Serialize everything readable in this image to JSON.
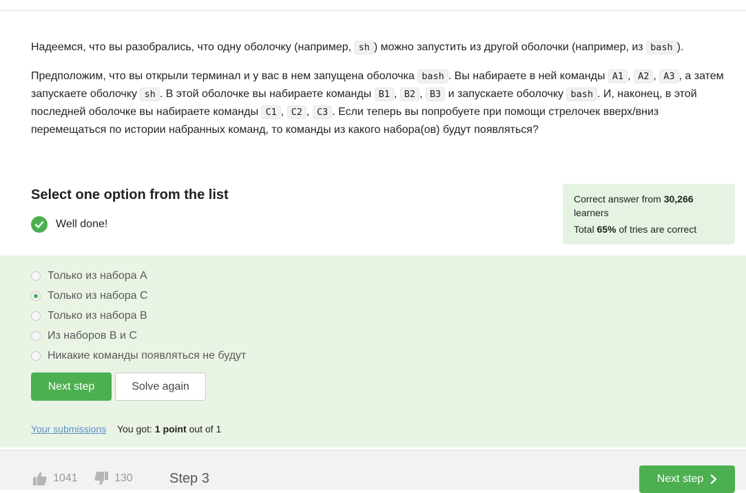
{
  "question": {
    "p1": {
      "t1": "Надеемся, что вы разобрались, что одну оболочку (например,",
      "c1": "sh",
      "t2": ") можно запустить из другой оболочки (например, из",
      "c2": "bash",
      "t3": ")."
    },
    "p2": {
      "t1": "Предположим, что вы открыли терминал и у вас в нем запущена оболочка",
      "c1": "bash",
      "t2": ". Вы набираете в ней команды",
      "c2": "A1",
      "s1": ",",
      "c3": "A2",
      "s2": ",",
      "c4": "A3",
      "t3": ", а затем запускаете оболочку",
      "c5": "sh",
      "t4": ". В этой оболочке вы набираете команды",
      "c6": "B1",
      "s3": ",",
      "c7": "B2",
      "s4": ",",
      "c8": "B3",
      "t5": "и запускаете оболочку",
      "c9": "bash",
      "t6": ". И, наконец, в этой последней оболочке вы набираете команды",
      "c10": "C1",
      "s5": ",",
      "c11": "C2",
      "s6": ",",
      "c12": "C3",
      "t7": ". Если теперь вы попробуете при помощи стрелочек вверх/вниз перемещаться по истории набранных команд, то команды из какого набора(ов) будут появляться?"
    }
  },
  "select_title": "Select one option from the list",
  "well_done": "Well done!",
  "stats": {
    "line1_prefix": "Correct answer from",
    "learners_count": "30,266",
    "line1_suffix": "learners",
    "line2_prefix": "Total",
    "percent": "65%",
    "line2_suffix": "of tries are correct"
  },
  "options": [
    {
      "label": "Только из набора A",
      "selected": false
    },
    {
      "label": "Только из набора C",
      "selected": true
    },
    {
      "label": "Только из набора B",
      "selected": false
    },
    {
      "label": "Из наборов B и C",
      "selected": false
    },
    {
      "label": "Никакие команды появляться не будут",
      "selected": false
    }
  ],
  "buttons": {
    "next_step": "Next step",
    "solve_again": "Solve again"
  },
  "submissions_link": "Your submissions",
  "result": {
    "prefix": "You got:",
    "points": "1 point",
    "suffix": "out of 1"
  },
  "footer": {
    "likes": "1041",
    "dislikes": "130",
    "step": "Step 3",
    "next_step": "Next step"
  },
  "colors": {
    "accent": "#4caf50",
    "correct_bg": "#e9f4e5",
    "link": "#5a8fc6"
  }
}
